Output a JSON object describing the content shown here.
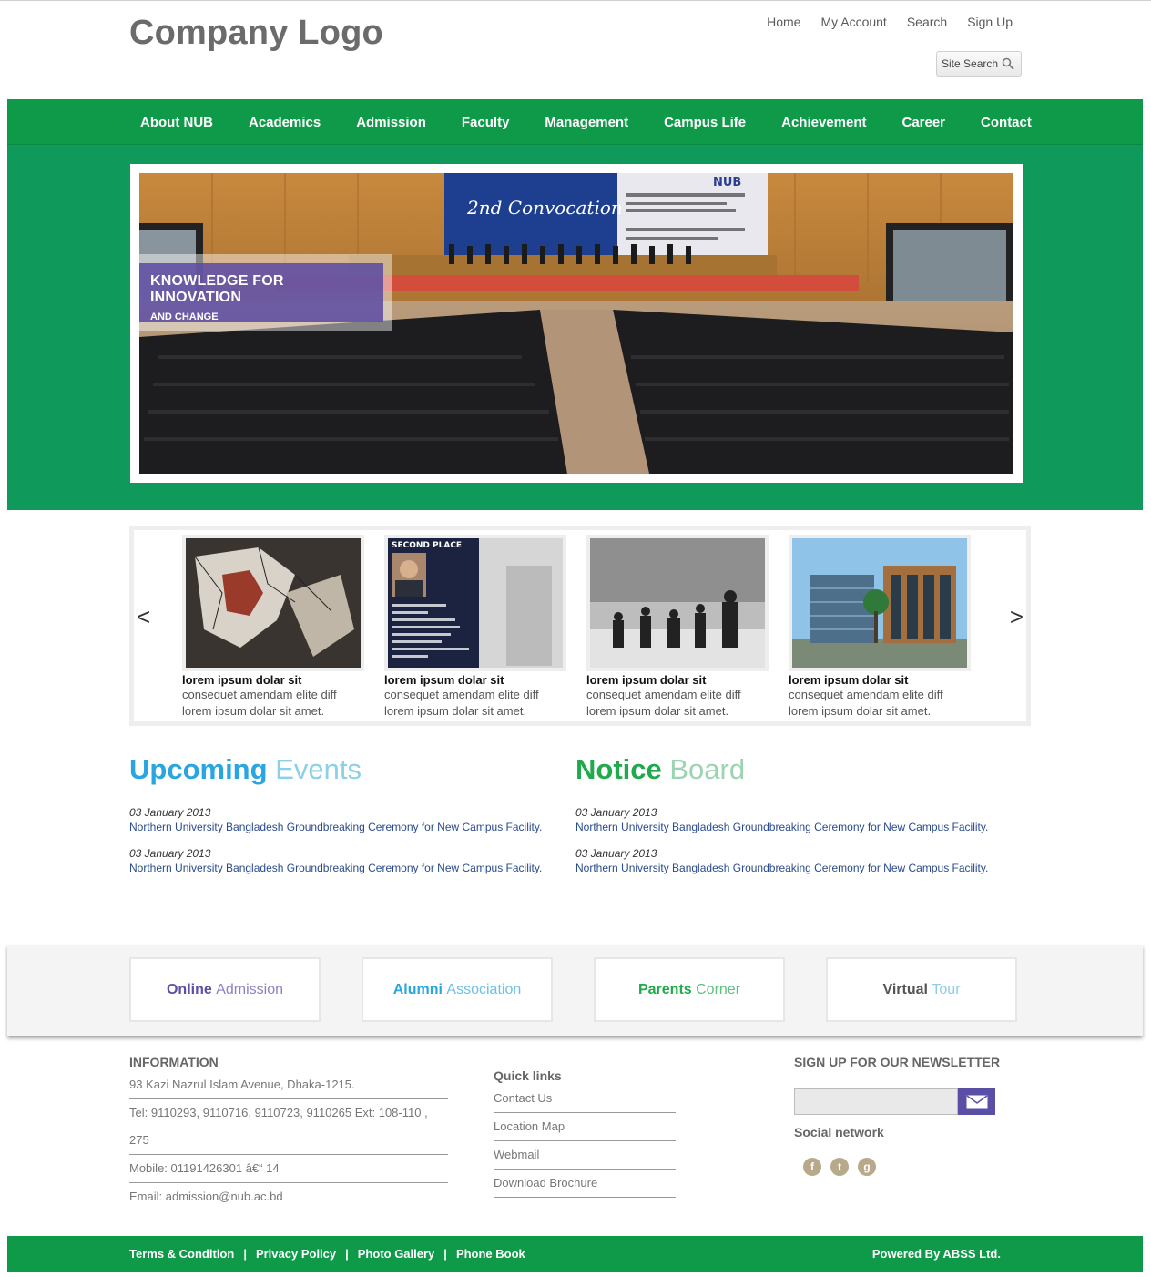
{
  "header": {
    "logo": "Company Logo",
    "top_links": [
      "Home",
      "My Account",
      "Search",
      "Sign Up"
    ],
    "search_label": "Site Search"
  },
  "nav": {
    "items": [
      "About NUB",
      "Academics",
      "Admission",
      "Faculty",
      "Management",
      "Campus Life",
      "Achievement",
      "Career",
      "Contact"
    ]
  },
  "hero": {
    "caption_title": "KNOWLEDGE FOR INNOVATION",
    "caption_sub": "AND CHANGE",
    "banner_brand": "NUB",
    "banner_event": "2nd Convocation"
  },
  "carousel": {
    "prev": "<",
    "next": ">",
    "items": [
      {
        "title": "lorem ipsum dolar sit",
        "line1": "consequet amendam elite diff",
        "line2": "lorem ipsum dolar sit amet."
      },
      {
        "title": "lorem ipsum dolar sit",
        "line1": "consequet amendam elite diff",
        "line2": "lorem ipsum dolar sit amet.",
        "badge": "SECOND PLACE"
      },
      {
        "title": "lorem ipsum dolar sit",
        "line1": "consequet amendam elite diff",
        "line2": "lorem ipsum dolar sit amet."
      },
      {
        "title": "lorem ipsum dolar sit",
        "line1": "consequet amendam elite diff",
        "line2": "lorem ipsum dolar sit amet."
      }
    ]
  },
  "events": {
    "title_strong": "Upcoming",
    "title_light": "Events",
    "items": [
      {
        "date": "03 January 2013",
        "text": "Northern University Bangladesh Groundbreaking Ceremony for New Campus Facility."
      },
      {
        "date": "03 January 2013",
        "text": "Northern University Bangladesh Groundbreaking Ceremony for New Campus Facility."
      }
    ]
  },
  "notices": {
    "title_strong": "Notice",
    "title_light": "Board",
    "items": [
      {
        "date": "03 January 2013",
        "text": "Northern University Bangladesh Groundbreaking Ceremony for New Campus Facility."
      },
      {
        "date": "03 January 2013",
        "text": "Northern University Bangladesh Groundbreaking Ceremony for New Campus Facility."
      }
    ]
  },
  "quick_boxes": [
    {
      "strong": "Online",
      "light": "Admission"
    },
    {
      "strong": "Alumni",
      "light": "Association"
    },
    {
      "strong": "Parents",
      "light": "Corner"
    },
    {
      "strong": "Virtual",
      "light": "Tour"
    }
  ],
  "footer": {
    "info_title": "INFORMATION",
    "info_lines": [
      "93 Kazi Nazrul Islam Avenue, Dhaka-1215.",
      "Tel: 9110293, 9110716, 9110723, 9110265 Ext: 108-110 ,",
      "275",
      "Mobile: 01191426301 â€“ 14",
      "Email: admission@nub.ac.bd"
    ],
    "quick_title": "Quick links",
    "quick_links": [
      "Contact Us",
      "Location Map",
      "Webmail",
      "Download Brochure"
    ],
    "newsletter_title": "SIGN UP FOR OUR NEWSLETTER",
    "social_title": "Social network"
  },
  "bottom": {
    "links": [
      "Terms & Condition",
      "Privacy Policy",
      "Photo Gallery",
      "Phone Book"
    ],
    "separator": "|",
    "powered": "Powered By ABSS Ltd."
  },
  "colors": {
    "nav_green": "#0f9a49",
    "hero_green": "#0f9a5c",
    "events_blue": "#29a6e0",
    "events_light": "#8ad0ea",
    "notice_green": "#1faa4b",
    "notice_light": "#9cd3b0",
    "caption_purple": "#5d4ca0",
    "online_purple": "#5b50a8",
    "alumni_blue": "#29a6e0",
    "parents_green": "#1faa4b",
    "virtual_grey": "#555555"
  },
  "icons": [
    "search-icon",
    "mail-icon",
    "facebook-icon",
    "twitter-icon",
    "googleplus-icon"
  ]
}
